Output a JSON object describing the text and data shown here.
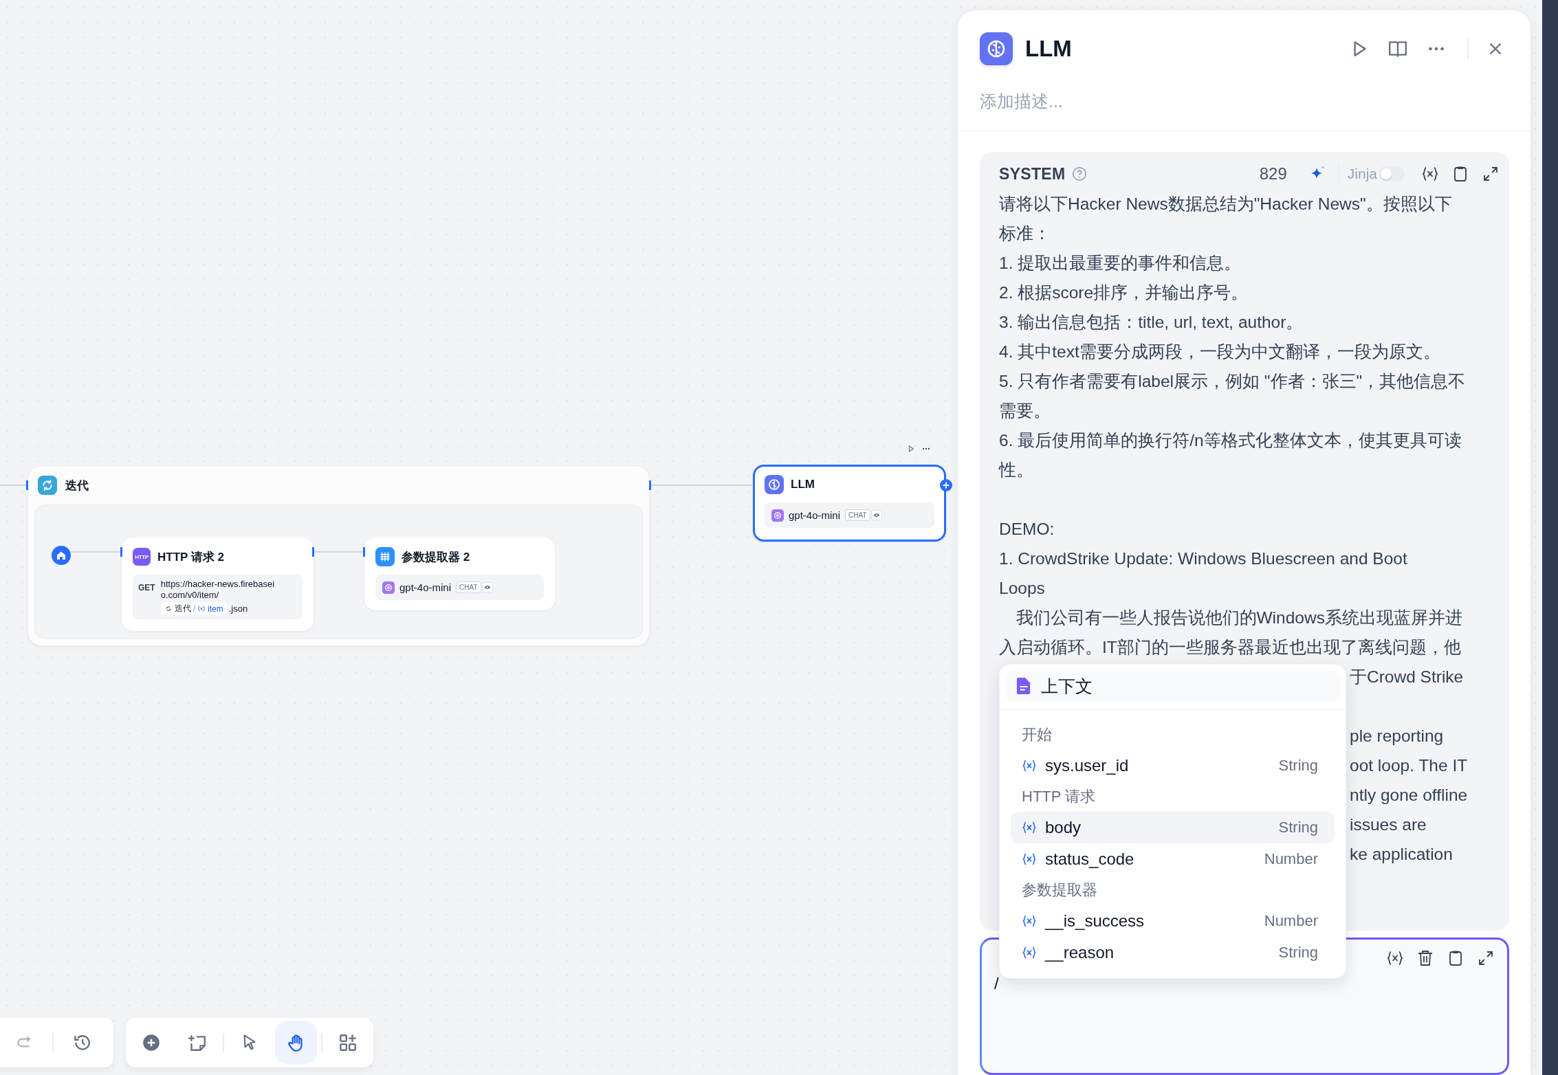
{
  "canvas": {
    "iteration_node": {
      "title": "迭代"
    },
    "http_node": {
      "icon_label": "HTTP",
      "title": "HTTP 请求 2",
      "method": "GET",
      "url_lines": [
        "https://hacker-news.firebasei",
        "o.com/v0/item/"
      ],
      "variable": {
        "node": "迭代",
        "separator": "/",
        "name": "item"
      },
      "suffix": ".json"
    },
    "extractor_node": {
      "title": "参数提取器 2",
      "model": "gpt-4o-mini",
      "mode": "CHAT"
    },
    "llm_node": {
      "title": "LLM",
      "model": "gpt-4o-mini",
      "mode": "CHAT",
      "selected": true
    }
  },
  "toolbar": {
    "history_tools": [
      {
        "kind": "redo",
        "disabled": true
      },
      {
        "kind": "history",
        "disabled": false
      }
    ],
    "canvas_tools": [
      [
        {
          "kind": "add",
          "selected": false
        },
        {
          "kind": "note",
          "selected": false
        }
      ],
      [
        {
          "kind": "pointer",
          "selected": false
        },
        {
          "kind": "hand",
          "selected": true
        }
      ],
      [
        {
          "kind": "organize",
          "selected": false
        }
      ]
    ]
  },
  "panel": {
    "title": "LLM",
    "description_placeholder": "添加描述...",
    "system": {
      "label": "SYSTEM",
      "count": "829",
      "jinja": {
        "label": "Jinja",
        "on": false
      },
      "paragraphs": [
        {
          "kind": "text",
          "lines": [
            "请将以下Hacker News数据总结为\"Hacker News\"。按照以下",
            "标准："
          ]
        },
        {
          "kind": "text",
          "lines": [
            "1. 提取出最重要的事件和信息。"
          ]
        },
        {
          "kind": "text",
          "lines": [
            "2. 根据score排序，并输出序号。"
          ]
        },
        {
          "kind": "text",
          "lines": [
            "3. 输出信息包括：title, url, text, author。"
          ]
        },
        {
          "kind": "text",
          "lines": [
            "4. 其中text需要分成两段，一段为中文翻译，一段为原文。"
          ]
        },
        {
          "kind": "text",
          "lines": [
            "5. 只有作者需要有label展示，例如 \"作者：张三\"，其他信息不",
            "需要。"
          ]
        },
        {
          "kind": "text",
          "lines": [
            "6. 最后使用简单的换行符/n等格式化整体文本，使其更具可读",
            "性。"
          ]
        },
        {
          "kind": "blank"
        },
        {
          "kind": "text",
          "lines": [
            "DEMO:"
          ]
        },
        {
          "kind": "text",
          "lines": [
            "1. CrowdStrike Update: Windows Bluescreen and Boot",
            "Loops"
          ]
        },
        {
          "kind": "indented",
          "lines": [
            "我们公司有一些人报告说他们的Windows系统出现蓝屏并进",
            "入启动循环。IT部门的一些服务器最近也出现了离线问题，他"
          ]
        },
        {
          "kind": "partial",
          "lines": [
            "于Crowd Strike"
          ]
        },
        {
          "kind": "blank"
        },
        {
          "kind": "partial",
          "lines": [
            "ple reporting"
          ]
        },
        {
          "kind": "partial",
          "lines": [
            "oot loop. The IT"
          ]
        },
        {
          "kind": "partial",
          "lines": [
            "ntly gone offline"
          ]
        },
        {
          "kind": "partial",
          "lines": [
            "issues are"
          ]
        },
        {
          "kind": "partial",
          "lines": [
            "ke application"
          ]
        }
      ]
    },
    "user_prompt": {
      "value": "/"
    },
    "variable_menu": {
      "context_label": "上下文",
      "groups": [
        {
          "title": "开始",
          "items": [
            {
              "name": "sys.user_id",
              "type": "String",
              "selected": false
            }
          ]
        },
        {
          "title": "HTTP 请求",
          "items": [
            {
              "name": "body",
              "type": "String",
              "selected": true
            },
            {
              "name": "status_code",
              "type": "Number",
              "selected": false
            }
          ]
        },
        {
          "title": "参数提取器",
          "items": [
            {
              "name": "__is_success",
              "type": "Number",
              "selected": false
            },
            {
              "name": "__reason",
              "type": "String",
              "selected": false
            }
          ]
        }
      ]
    }
  }
}
